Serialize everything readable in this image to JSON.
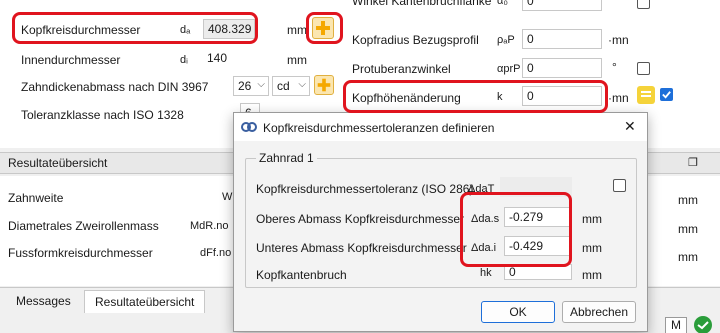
{
  "top": {
    "kopfkreis_label": "Kopfkreisdurchmesser",
    "kopfkreis_sym": "dₐ",
    "kopfkreis_value": "408.329",
    "kopfkreis_unit": "mm",
    "innen_label": "Innendurchmesser",
    "innen_sym": "dᵢ",
    "innen_value": "140",
    "innen_unit": "mm",
    "zahndicke_label": "Zahndickenabmass nach DIN 3967",
    "zahndicke_num": "26",
    "zahndicke_code": "cd",
    "toleranz_label": "Toleranzklasse nach ISO 1328",
    "toleranz_value": "6",
    "winkel_label": "Winkel Kantenbruchflanke",
    "winkel_sym": "α₀",
    "winkel_value": "0",
    "kopfradius_label": "Kopfradius Bezugsprofil",
    "kopfradius_sym": "ρₐP",
    "kopfradius_value": "0",
    "kopfradius_unit": "·mn",
    "protub_label": "Protuberanzwinkel",
    "protub_sym": "αprP",
    "protub_value": "0",
    "protub_unit": "°",
    "kopfhoehe_label": "Kopfhöhenänderung",
    "kopfhoehe_sym": "k",
    "kopfhoehe_value": "0",
    "kopfhoehe_unit": "·mn"
  },
  "result": {
    "title": "Resultateübersicht",
    "rows": [
      {
        "label": "Zahnweite",
        "sym": "W",
        "unit": "mm"
      },
      {
        "label": "Diametrales Zweirollenmass",
        "sym": "MdR.no",
        "unit": "mm"
      },
      {
        "label": "Fussformkreisdurchmesser",
        "sym": "dFf.no",
        "unit": "mm"
      }
    ]
  },
  "tabs": [
    "Messages",
    "Resultateübersicht"
  ],
  "dialog": {
    "title": "Kopfkreisdurchmessertoleranzen definieren",
    "close": "✕",
    "group": "Zahnrad 1",
    "rows": [
      {
        "label": "Kopfkreisdurchmessertoleranz (ISO 286)",
        "sym": "ΔdaT",
        "value": "",
        "unit": ""
      },
      {
        "label": "Oberes Abmass Kopfkreisdurchmesser",
        "sym": "Δda.s",
        "value": "-0.279",
        "unit": "mm"
      },
      {
        "label": "Unteres Abmass Kopfkreisdurchmesser",
        "sym": "Δda.i",
        "value": "-0.429",
        "unit": "mm"
      },
      {
        "label": "Kopfkantenbruch",
        "sym": "hk",
        "value": "0",
        "unit": "mm"
      }
    ],
    "ok": "OK",
    "cancel": "Abbrechen"
  },
  "statusbar": {
    "m_label": "M"
  },
  "colors": {
    "highlight": "#e0141e",
    "accent": "#1e6fd9",
    "plus": "#f5a800"
  }
}
